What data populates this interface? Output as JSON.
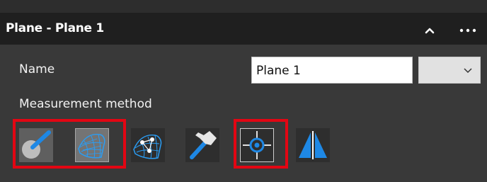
{
  "panel": {
    "title": "Plane - Plane 1",
    "collapse_icon": "chevron-up-icon",
    "more_icon": "more-icon"
  },
  "name": {
    "label": "Name",
    "value": "Plane 1",
    "dropdown_icon": "chevron-down-icon"
  },
  "measurement_method": {
    "label": "Measurement method",
    "tools": [
      {
        "icon": "probe-point-icon",
        "selected": false,
        "highlighted": true
      },
      {
        "icon": "mesh-surface-icon",
        "selected": true,
        "highlighted": true
      },
      {
        "icon": "mesh-points-icon",
        "selected": false,
        "highlighted": false
      },
      {
        "icon": "hammer-icon",
        "selected": false,
        "highlighted": false
      },
      {
        "icon": "crosshair-target-icon",
        "selected": false,
        "highlighted": true
      },
      {
        "icon": "mirror-triangles-icon",
        "selected": false,
        "highlighted": false
      }
    ]
  },
  "colors": {
    "header_background": "#1f1f1f",
    "panel_background": "#393939",
    "accent_blue": "#1e88e5",
    "highlight_red": "#e30613"
  }
}
